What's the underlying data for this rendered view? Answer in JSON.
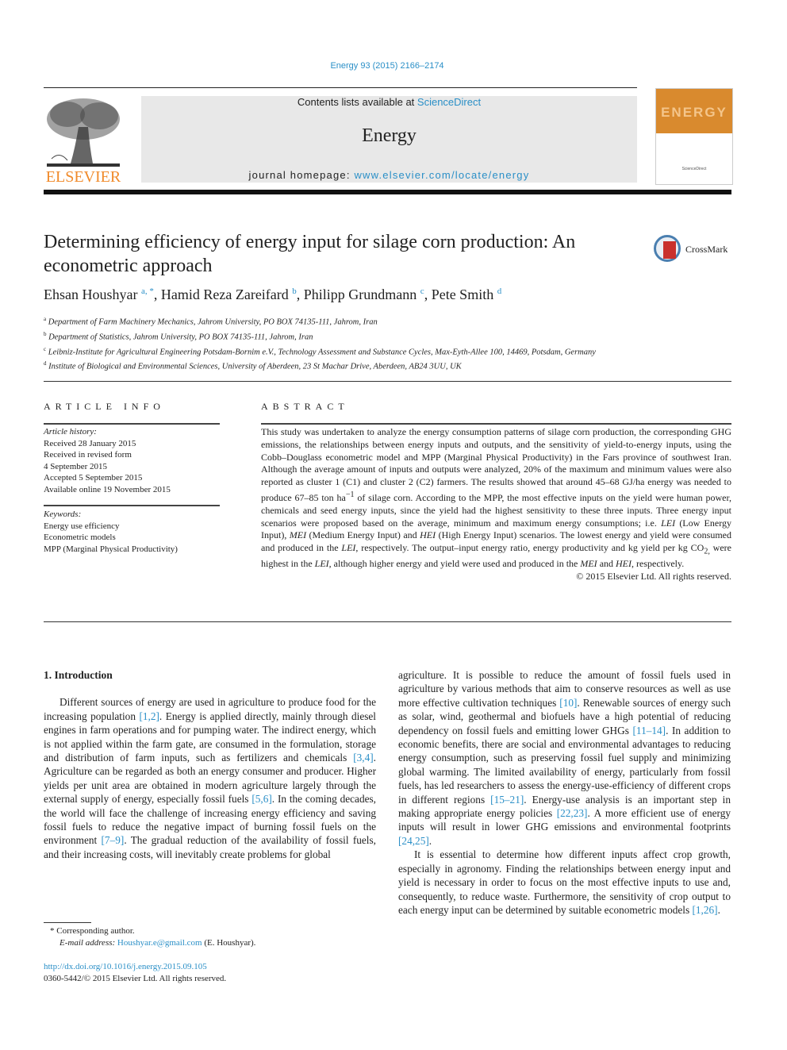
{
  "header": {
    "journal_ref": "Energy 93 (2015) 2166–2174",
    "publisher_logo_text": "ELSEVIER",
    "contents_prefix": "Contents lists available at ",
    "contents_link": "ScienceDirect",
    "journal_name": "Energy",
    "homepage_prefix": "journal homepage: ",
    "homepage_link": "www.elsevier.com/locate/energy",
    "cover_title": "ENERGY",
    "cover_footer": "ScienceDirect",
    "crossmark_label": "CrossMark"
  },
  "article": {
    "title": "Determining efficiency of energy input for silage corn production: An econometric approach",
    "authors": [
      {
        "name": "Ehsan Houshyar",
        "sup": "a, *"
      },
      {
        "name": "Hamid Reza Zareifard",
        "sup": "b"
      },
      {
        "name": "Philipp Grundmann",
        "sup": "c"
      },
      {
        "name": "Pete Smith",
        "sup": "d"
      }
    ],
    "affiliations": [
      {
        "sup": "a",
        "text": "Department of Farm Machinery Mechanics, Jahrom University, PO BOX 74135-111, Jahrom, Iran"
      },
      {
        "sup": "b",
        "text": "Department of Statistics, Jahrom University, PO BOX 74135-111, Jahrom, Iran"
      },
      {
        "sup": "c",
        "text": "Leibniz-Institute for Agricultural Engineering Potsdam-Bornim e.V., Technology Assessment and Substance Cycles, Max-Eyth-Allee 100, 14469, Potsdam, Germany"
      },
      {
        "sup": "d",
        "text": "Institute of Biological and Environmental Sciences, University of Aberdeen, 23 St Machar Drive, Aberdeen, AB24 3UU, UK"
      }
    ]
  },
  "article_info": {
    "heading": "ARTICLE INFO",
    "history_label": "Article history:",
    "history": [
      "Received 28 January 2015",
      "Received in revised form",
      "4 September 2015",
      "Accepted 5 September 2015",
      "Available online 19 November 2015"
    ],
    "keywords_label": "Keywords:",
    "keywords": [
      "Energy use efficiency",
      "Econometric models",
      "MPP (Marginal Physical Productivity)"
    ]
  },
  "abstract": {
    "heading": "ABSTRACT",
    "p1": "This study was undertaken to analyze the energy consumption patterns of silage corn production, the corresponding GHG emissions, the relationships between energy inputs and outputs, and the sensitivity of yield-to-energy inputs, using the Cobb–Douglass econometric model and MPP (Marginal Physical Productivity) in the Fars province of southwest Iran. Although the average amount of inputs and outputs were analyzed, 20% of the maximum and minimum values were also reported as cluster 1 (C1) and cluster 2 (C2) farmers. The results showed that around 45–68 GJ/ha energy was needed to produce 67–85 ton ha",
    "sup1": "−1",
    "p2": " of silage corn. According to the MPP, the most effective inputs on the yield were human power, chemicals and seed energy inputs, since the yield had the highest sensitivity to these three inputs. Three energy input scenarios were proposed based on the average, minimum and maximum energy consumptions; i.e. ",
    "lei": "LEI",
    "p3": " (Low Energy Input), ",
    "mei": "MEI",
    "p4": " (Medium Energy Input) and ",
    "hei": "HEI",
    "p5": " (High Energy Input) scenarios. The lowest energy and yield were consumed and produced in the ",
    "p6": ", respectively. The output–input energy ratio, energy productivity and kg yield per kg CO",
    "sub_co2": "2,",
    "p7": " were highest in the ",
    "p8": ", although higher energy and yield were used and produced in the ",
    "p9": " and ",
    "p10": ", respectively.",
    "copyright": "© 2015 Elsevier Ltd. All rights reserved."
  },
  "introduction": {
    "heading": "1.  Introduction",
    "left": [
      {
        "t": "Different sources of energy are used in agriculture to produce food for the increasing population "
      },
      {
        "ref": "[1,2]"
      },
      {
        "t": ". Energy is applied directly, mainly through diesel engines in farm operations and for pumping water. The indirect energy, which is not applied within the farm gate, are consumed in the formulation, storage and distribution of farm inputs, such as fertilizers and chemicals "
      },
      {
        "ref": "[3,4]"
      },
      {
        "t": ". Agriculture can be regarded as both an energy consumer and producer. Higher yields per unit area are obtained in modern agriculture largely through the external supply of energy, especially fossil fuels "
      },
      {
        "ref": "[5,6]"
      },
      {
        "t": ". In the coming decades, the world will face the challenge of increasing energy efficiency and saving fossil fuels to reduce the negative impact of burning fossil fuels on the environment "
      },
      {
        "ref": "[7–9]"
      },
      {
        "t": ". The gradual reduction of the availability of fossil fuels, and their increasing costs, will inevitably create problems for global"
      }
    ],
    "right_p1": [
      {
        "t": "agriculture. It is possible to reduce the amount of fossil fuels used in agriculture by various methods that aim to conserve resources as well as use more effective cultivation techniques "
      },
      {
        "ref": "[10]"
      },
      {
        "t": ". Renewable sources of energy such as solar, wind, geothermal and biofuels have a high potential of reducing dependency on fossil fuels and emitting lower GHGs "
      },
      {
        "ref": "[11–14]"
      },
      {
        "t": ". In addition to economic benefits, there are social and environmental advantages to reducing energy consumption, such as preserving fossil fuel supply and minimizing global warming. The limited availability of energy, particularly from fossil fuels, has led researchers to assess the energy-use-efficiency of different crops in different regions "
      },
      {
        "ref": "[15–21]"
      },
      {
        "t": ". Energy-use analysis is an important step in making appropriate energy policies "
      },
      {
        "ref": "[22,23]"
      },
      {
        "t": ". A more efficient use of energy inputs will result in lower GHG emissions and environmental footprints "
      },
      {
        "ref": "[24,25]"
      },
      {
        "t": "."
      }
    ],
    "right_p2": [
      {
        "t": "It is essential to determine how different inputs affect crop growth, especially in agronomy. Finding the relationships between energy input and yield is necessary in order to focus on the most effective inputs to use and, consequently, to reduce waste. Furthermore, the sensitivity of crop output to each energy input can be determined by suitable econometric models "
      },
      {
        "ref": "[1,26]"
      },
      {
        "t": "."
      }
    ]
  },
  "footer": {
    "corresponding": "* Corresponding author.",
    "email_label": "E-mail address: ",
    "email": "Houshyar.e@gmail.com",
    "email_suffix": " (E. Houshyar).",
    "doi": "http://dx.doi.org/10.1016/j.energy.2015.09.105",
    "issn": "0360-5442/© 2015 Elsevier Ltd. All rights reserved."
  }
}
